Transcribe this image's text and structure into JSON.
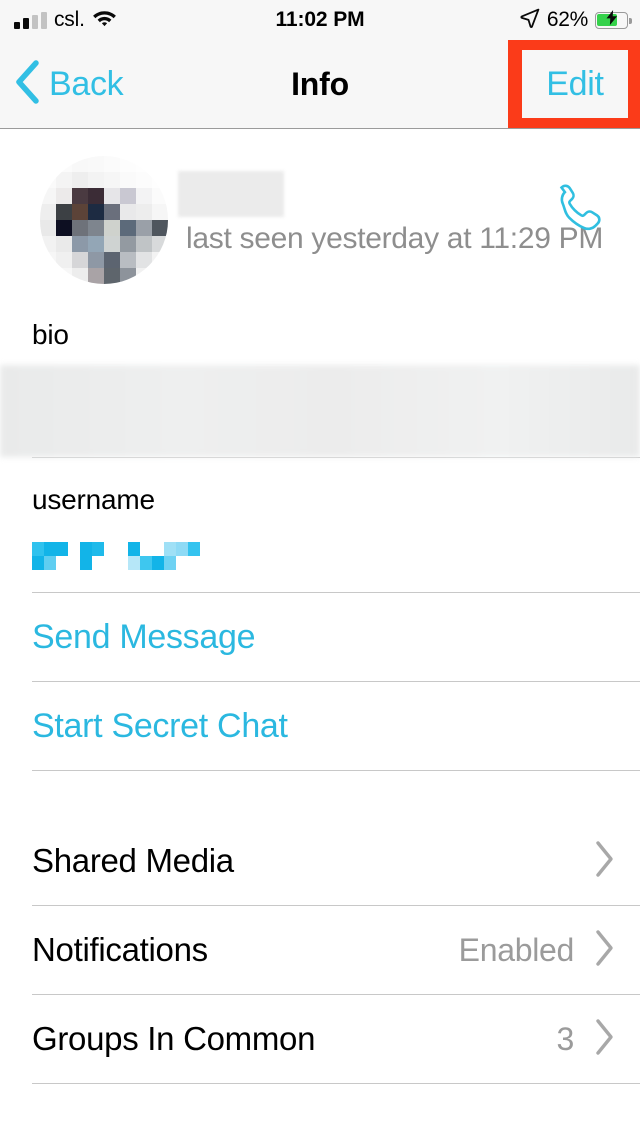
{
  "status_bar": {
    "carrier": "csl.",
    "signal_icon": "signal-bars-icon",
    "wifi_icon": "wifi-icon",
    "time": "11:02 PM",
    "location_icon": "location-arrow-icon",
    "battery_percent": "62%",
    "battery_level": 62,
    "battery_icon": "battery-charging-icon"
  },
  "nav_bar": {
    "back_label": "Back",
    "back_icon": "chevron-left-icon",
    "title": "Info",
    "edit_label": "Edit",
    "highlight_color": "#fb3b19",
    "accent_color": "#32bfe4"
  },
  "profile": {
    "avatar_icon": "avatar-pixelated",
    "name_redacted": true,
    "last_seen": "last seen yesterday at 11:29 PM",
    "call_icon": "phone-call-icon"
  },
  "sections": {
    "bio": {
      "label": "bio",
      "value_redacted": true
    },
    "username": {
      "label": "username",
      "value_redacted": true
    }
  },
  "actions": [
    {
      "label": "Send Message",
      "name": "send-message-link"
    },
    {
      "label": "Start Secret Chat",
      "name": "start-secret-chat-link"
    }
  ],
  "list_rows": [
    {
      "label": "Shared Media",
      "value": "",
      "name": "shared-media-row"
    },
    {
      "label": "Notifications",
      "value": "Enabled",
      "name": "notifications-row"
    },
    {
      "label": "Groups In Common",
      "value": "3",
      "name": "groups-in-common-row"
    }
  ],
  "colors": {
    "accent": "#2bb8e0",
    "highlight": "#fb3b19",
    "muted_text": "#9b9b9b",
    "battery_green": "#35d24b"
  }
}
